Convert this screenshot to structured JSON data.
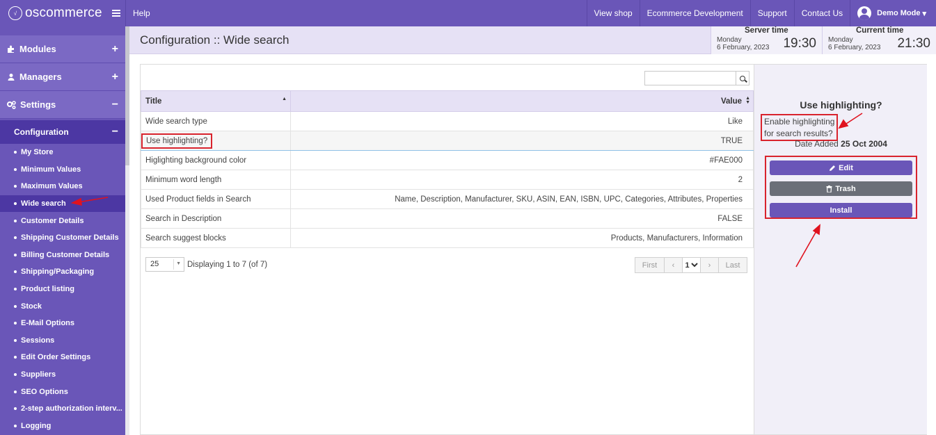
{
  "topbar": {
    "logo_text": "oscommerce",
    "logo_mark": "√",
    "help": "Help",
    "view_shop": "View shop",
    "ecommerce_dev": "Ecommerce Development",
    "support": "Support",
    "contact_us": "Contact Us",
    "user": "Demo Mode",
    "user_caret": "▾"
  },
  "sidebar": {
    "modules": "Modules",
    "managers": "Managers",
    "settings": "Settings",
    "configuration": "Configuration",
    "plus": "+",
    "minus": "−",
    "items": [
      "My Store",
      "Minimum Values",
      "Maximum Values",
      "Wide search",
      "Customer Details",
      "Shipping Customer Details",
      "Billing Customer Details",
      "Shipping/Packaging",
      "Product listing",
      "Stock",
      "E-Mail Options",
      "Sessions",
      "Edit Order Settings",
      "Suppliers",
      "SEO Options",
      "2-step authorization interv...",
      "Logging"
    ],
    "active_item": "Wide search"
  },
  "header": {
    "title": "Configuration :: Wide search",
    "server_time": {
      "label": "Server time",
      "day": "Monday",
      "date": "6 February, 2023",
      "time": "19:30"
    },
    "current_time": {
      "label": "Current time",
      "day": "Monday",
      "date": "6 February, 2023",
      "time": "21:30"
    }
  },
  "table": {
    "col_title": "Title",
    "col_value": "Value",
    "rows": [
      {
        "title": "Wide search type",
        "value": "Like"
      },
      {
        "title": "Use highlighting?",
        "value": "TRUE"
      },
      {
        "title": "Higlighting background color",
        "value": "#FAE000"
      },
      {
        "title": "Minimum word length",
        "value": "2"
      },
      {
        "title": "Used Product fields in Search",
        "value": "Name, Description, Manufacturer, SKU, ASIN, EAN, ISBN, UPC, Categories, Attributes, Properties"
      },
      {
        "title": "Search in Description",
        "value": "FALSE"
      },
      {
        "title": "Search suggest blocks",
        "value": "Products, Manufacturers, Information"
      }
    ],
    "selected_row": 1
  },
  "pagination": {
    "per_page": "25",
    "display_info": "Displaying 1 to 7 (of 7)",
    "first": "First",
    "prev": "‹",
    "page": "1",
    "next": "›",
    "last": "Last"
  },
  "info_panel": {
    "title": "Use highlighting?",
    "description_line1": "Enable highlighting",
    "description_line2": "for search results?",
    "date_label": "Date Added",
    "date_value": "25 Oct 2004",
    "edit": "Edit",
    "trash": "Trash",
    "install": "Install"
  },
  "colors": {
    "brand": "#6a56b8",
    "brand_dark": "#4c37a3",
    "header_band": "#e6e1f5",
    "trash_button": "#6b6f78",
    "annotation_red": "#d9232d"
  }
}
